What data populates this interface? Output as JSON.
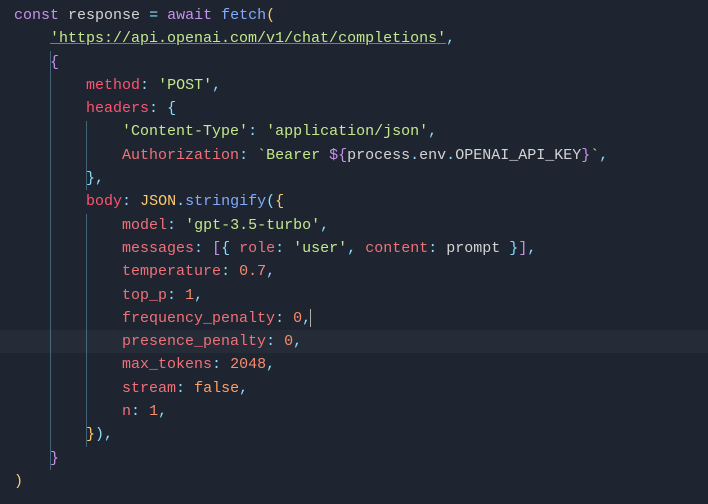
{
  "code": {
    "l1_kw1": "const",
    "l1_var": "response",
    "l1_op": "=",
    "l1_kw2": "await",
    "l1_fn": "fetch",
    "l1_par": "(",
    "l2_url": "'https://api.openai.com/v1/chat/completions'",
    "l2_comma": ",",
    "l3_brace": "{",
    "l4_key": "method",
    "l4_val": "'POST'",
    "l5_key": "headers",
    "l6_key": "'Content-Type'",
    "l6_val": "'application/json'",
    "l7_key": "Authorization",
    "l7_tpl1": "`Bearer ",
    "l7_tpl_open": "${",
    "l7_proc": "process",
    "l7_env": "env",
    "l7_apikey": "OPENAI_API_KEY",
    "l7_tpl_close": "}",
    "l7_tpl2": "`",
    "l9_key": "body",
    "l9_obj": "JSON",
    "l9_fn": "stringify",
    "l10_key": "model",
    "l10_val": "'gpt-3.5-turbo'",
    "l11_key": "messages",
    "l11_role_k": "role",
    "l11_role_v": "'user'",
    "l11_cont_k": "content",
    "l11_cont_v": "prompt",
    "l12_key": "temperature",
    "l12_val": "0.7",
    "l13_key": "top_p",
    "l13_val": "1",
    "l14_key": "frequency_penalty",
    "l14_val": "0",
    "l15_key": "presence_penalty",
    "l15_val": "0",
    "l16_key": "max_tokens",
    "l16_val": "2048",
    "l17_key": "stream",
    "l17_val": "false",
    "l18_key": "n",
    "l18_val": "1",
    "close_body": "})",
    "close_opts": "}",
    "close_call": ")"
  }
}
